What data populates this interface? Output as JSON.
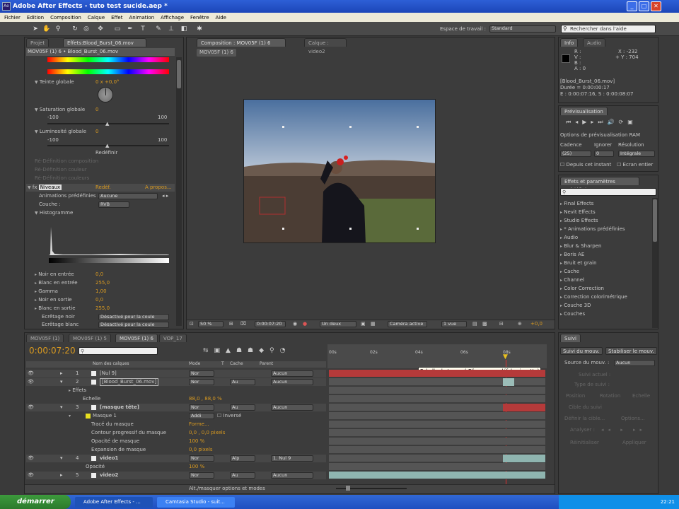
{
  "window": {
    "title": "Adobe After Effects - tuto test sucide.aep *",
    "app_icon": "Ae",
    "minimize": "_",
    "maximize": "□",
    "close": "✕"
  },
  "menu": [
    "Fichier",
    "Edition",
    "Composition",
    "Calque",
    "Effet",
    "Animation",
    "Affichage",
    "Fenêtre",
    "Aide"
  ],
  "toolbar": {
    "workspace_label": "Espace de travail :",
    "workspace_value": "Standard",
    "help_placeholder": "Rechercher dans l'aide"
  },
  "effects_panel": {
    "tabs": [
      "Projet",
      "Effets:Blood_Burst_06.mov"
    ],
    "subtitle": "MOV05F (1) 6 • Blood_Burst_06.mov",
    "teinte_label": "Teinte globale",
    "teinte_value": "0 x +0,0°",
    "saturation_label": "Saturation globale",
    "saturation_value": "0",
    "sat_min": "-100",
    "sat_max": "100",
    "luminosite_label": "Luminosité globale",
    "luminosite_value": "0",
    "lum_min": "-100",
    "lum_max": "100",
    "redefine": "Redéfinir",
    "dim_rows": [
      "Ré-Définition composition",
      "Ré-Définition couleur",
      "Ré-Définition couleurs"
    ],
    "niveaux_label": "Niveaux",
    "niveaux_reset": "Redéf.",
    "niveaux_about": "A propos...",
    "anim_label": "Animations prédéfinies :",
    "anim_value": "Aucune",
    "couche_label": "Couche :",
    "couche_value": "RVB",
    "histogram_label": "Histogramme",
    "params": [
      {
        "label": "Noir en entrée",
        "value": "0,0"
      },
      {
        "label": "Blanc en entrée",
        "value": "255,0"
      },
      {
        "label": "Gamma",
        "value": "1,00"
      },
      {
        "label": "Noir en sortie",
        "value": "0,0"
      },
      {
        "label": "Blanc en sortie",
        "value": "255,0"
      }
    ],
    "ecretage_noir": "Ecrêtage noir",
    "ecretage_noir_value": "Désactivé pour la coule",
    "ecretage_blanc": "Ecrêtage blanc",
    "ecretage_blanc_value": "Désactivé pour la coule"
  },
  "comp_panel": {
    "tab": "Composition : MOV05F (1) 6",
    "layer_tab": "Calque : video2",
    "comp_label": "MOV05F (1) 6",
    "zoom": "50 %",
    "timecode": "0:00:07:20",
    "resolution": "Un deux",
    "camera": "Caméra active",
    "views": "1 vue",
    "exposure": "+0,0"
  },
  "info_panel": {
    "tabs": [
      "Info",
      "Audio"
    ],
    "r": "R :",
    "g": "V :",
    "b": "B :",
    "a": "A : 0",
    "x": "X : -232",
    "y": "+ Y : 704",
    "file": "[Blood_Burst_06.mov]",
    "duree": "Durée = 0:00:00:17",
    "entree": "E : 0:00:07:16, S : 0:00:08:07"
  },
  "preview_panel": {
    "title": "Prévisualisation",
    "ram_options": "Options de prévisualisation RAM",
    "cadence_label": "Cadence",
    "ignorer_label": "Ignorer",
    "resolution_label": "Résolution",
    "cadence_value": "(25)",
    "ignorer_value": "0",
    "resolution_value": "Intégrale",
    "from_current": "Depuis cet instant",
    "fullscreen": "Ecran entier"
  },
  "effects_presets": {
    "title": "Effets et paramètres prédéfinis",
    "items": [
      "Final Effects",
      "Nevit Effects",
      "Studio Effects",
      "* Animations prédéfinies",
      "Audio",
      "Blur & Sharpen",
      "Boris AE",
      "Bruit et grain",
      "Cache",
      "Channel",
      "Color Correction",
      "Correction colorimétrique",
      "Couche 3D",
      "Couches"
    ]
  },
  "timeline": {
    "tabs": [
      "MOV05F (1)",
      "MOV05F (1) 5",
      "MOV05F (1) 6",
      "VOP_17"
    ],
    "timecode": "0:00:07:20",
    "headers": {
      "nom": "Nom des calques",
      "mode": "Mode",
      "t": "T",
      "cache": "Cache",
      "parent": "Parent"
    },
    "ruler": [
      "00s",
      "02s",
      "04s",
      "06s",
      "08s"
    ],
    "tooltip": "Echelle de temps ( Cliquer pour déf. la vignette)",
    "layers": [
      {
        "num": "1",
        "name": "[Nul 9]",
        "mode": "Nor",
        "cache": "",
        "parent": "Aucun",
        "color": "#d8d8d8"
      },
      {
        "num": "2",
        "name": "[Blood_Burst_06.mov]",
        "mode": "Nor",
        "cache": "Au",
        "parent": "Aucun",
        "color": "#d8d8d8"
      },
      {
        "num": "3",
        "name": "[masque tête]",
        "mode": "Nor",
        "cache": "Au",
        "parent": "Aucun",
        "color": "#d8d8d8"
      },
      {
        "num": "4",
        "name": "video1",
        "mode": "Nor",
        "cache": "Alp",
        "parent": "1. Nul 9",
        "color": "#d8d8d8"
      },
      {
        "num": "5",
        "name": "video2",
        "mode": "Nor",
        "cache": "Au",
        "parent": "Aucun",
        "color": "#d8d8d8"
      }
    ],
    "effets_label": "Effets",
    "echelle_label": "Echelle",
    "echelle_value": "88,0 , 88,0 %",
    "masque_label": "Masque 1",
    "masque_mode": "Addi",
    "inverse_label": "Inversé",
    "trace_label": "Tracé du masque",
    "trace_value": "Forme...",
    "contour_label": "Contour progressif du masque",
    "contour_value": "0,0 , 0,0 pixels",
    "opacite_masque_label": "Opacité de masque",
    "opacite_masque_value": "100 %",
    "expansion_label": "Expansion de masque",
    "expansion_value": "0,0 pixels",
    "opacite_label": "Opacité",
    "opacite_value": "100 %",
    "footer": "Alt./masquer options et modes"
  },
  "suivi_panel": {
    "title": "Suivi",
    "track_motion": "Suivi du mouv.",
    "stabilize": "Stabiliser le mouv.",
    "source_label": "Source du mouv. :",
    "source_value": "Aucun",
    "dim_items": [
      "Suivi actuel :",
      "Type de suivi :",
      "Position",
      "Rotation",
      "Echelle",
      "Cible du suivi",
      "Définir la cible...",
      "Options...",
      "Analyser :",
      "Réinitialiser",
      "Appliquer"
    ]
  },
  "taskbar": {
    "start": "démarrer",
    "task1": "Adobe After Effects - ...",
    "task2": "Camtasia Studio - suit...",
    "clock": "22:21"
  }
}
